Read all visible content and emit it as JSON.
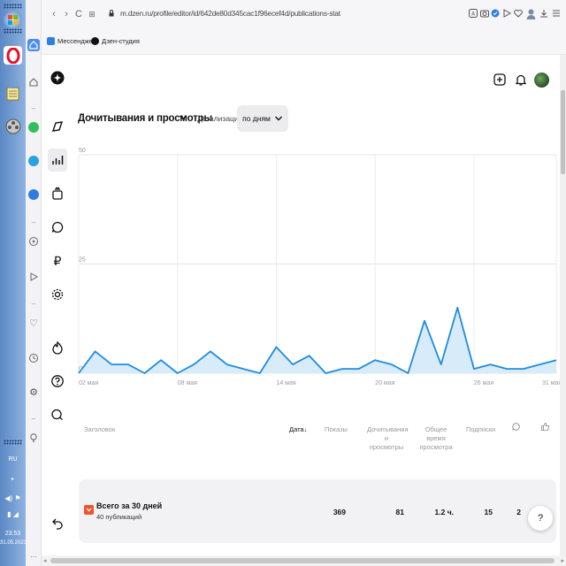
{
  "browser": {
    "url": "m.dzen.ru/profile/editor/id/642de80d345cac1f96ecef4d/publications-stat",
    "bookmarks": [
      {
        "label": "Мессенджер"
      },
      {
        "label": "Дзен-студия"
      }
    ]
  },
  "taskbar": {
    "lang": "RU",
    "time": "23:53",
    "date": "31.05.2023"
  },
  "header": {
    "title": "Дочитывания и просмотры",
    "detail_label": "Детализация",
    "detail_value": "по дням"
  },
  "chart_data": {
    "type": "area",
    "title": "",
    "xlabel": "",
    "ylabel": "",
    "ylim": [
      0,
      50
    ],
    "yticks": [
      0,
      25,
      50
    ],
    "x_tick_labels": [
      "02 мая",
      "08 мая",
      "14 мая",
      "20 мая",
      "26 мая",
      "31 мая"
    ],
    "x_tick_index": [
      0,
      6,
      12,
      18,
      24,
      29
    ],
    "grid": true,
    "color": "#1e8ce0",
    "fill": "#d8ebf9",
    "x": [
      "02 мая",
      "03 мая",
      "04 мая",
      "05 мая",
      "06 мая",
      "07 мая",
      "08 мая",
      "09 мая",
      "10 мая",
      "11 мая",
      "12 мая",
      "13 мая",
      "14 мая",
      "15 мая",
      "16 мая",
      "17 мая",
      "18 мая",
      "19 мая",
      "20 мая",
      "21 мая",
      "22 мая",
      "23 мая",
      "24 мая",
      "25 мая",
      "26 мая",
      "27 мая",
      "28 мая",
      "29 мая",
      "30 мая",
      "31 мая"
    ],
    "values": [
      0,
      5,
      2,
      2,
      0,
      3,
      0,
      2,
      5,
      2,
      1,
      0,
      6,
      2,
      4,
      0,
      1,
      1,
      3,
      2,
      0,
      12,
      2,
      15,
      1,
      2,
      1,
      1,
      2,
      3
    ]
  },
  "table": {
    "columns": [
      {
        "label": "Заголовок"
      },
      {
        "label": "Дата"
      },
      {
        "label": "Показы"
      },
      {
        "label": "Дочитывания и просмотры"
      },
      {
        "label": "Общее время просмотра"
      },
      {
        "label": "Подписки"
      }
    ],
    "total": {
      "title": "Всего за 30 дней",
      "subtitle": "40 публикаций",
      "shows": "369",
      "reads": "81",
      "time": "1.2 ч.",
      "subs": "15",
      "comments": "2"
    }
  },
  "help_label": "?"
}
